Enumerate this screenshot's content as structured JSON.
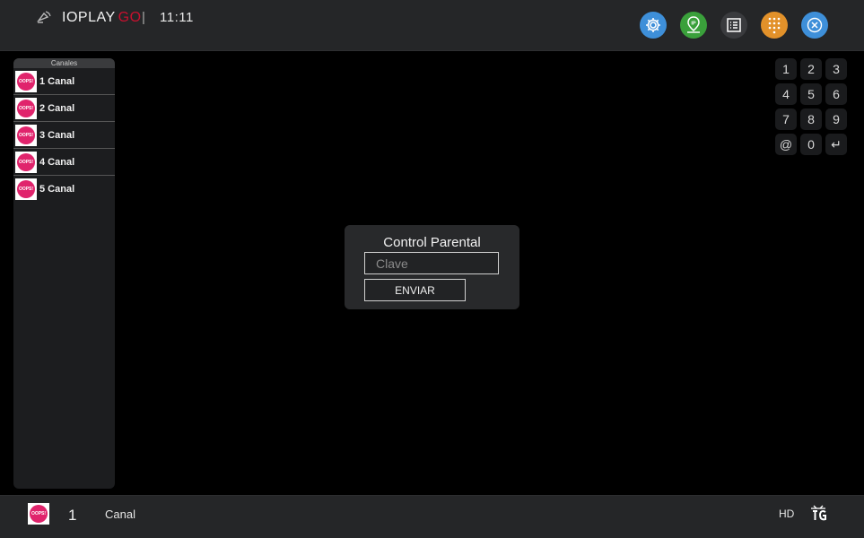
{
  "header": {
    "brand_main": "IOPLAY",
    "brand_suffix": "GO",
    "divider": "|",
    "clock": "11:11"
  },
  "sidebar": {
    "title": "Canales",
    "channels": [
      {
        "label": "1 Canal",
        "logo_text": "OOPS!"
      },
      {
        "label": "2 Canal",
        "logo_text": "OOPS!"
      },
      {
        "label": "3 Canal",
        "logo_text": "OOPS!"
      },
      {
        "label": "4 Canal",
        "logo_text": "OOPS!"
      },
      {
        "label": "5 Canal",
        "logo_text": "OOPS!"
      }
    ]
  },
  "keypad": {
    "keys": [
      "1",
      "2",
      "3",
      "4",
      "5",
      "6",
      "7",
      "8",
      "9",
      "@",
      "0",
      "↵"
    ]
  },
  "dialog": {
    "title": "Control Parental",
    "input_value": "",
    "input_placeholder": "Clave",
    "submit_label": "ENVIAR"
  },
  "footer": {
    "logo_text": "OOPS!",
    "channel_number": "1",
    "channel_name": "Canal",
    "quality": "HD"
  },
  "colors": {
    "settings_button": "#3e8fd9",
    "ip_button": "#3aa03b",
    "list_button": "#3a3b3e",
    "dialpad_button": "#e2912a",
    "close_button": "#3e8fd9",
    "channel_logo": "#e0246c",
    "brand_go": "#c8102e"
  },
  "icons": {
    "app_logo": "satellite-dish-icon",
    "settings": "gear-icon",
    "ip": "map-pin-ip-icon",
    "list": "list-icon",
    "dialpad": "dialpad-icon",
    "close": "close-circle-icon",
    "epg": "epg-tv-guide-icon"
  }
}
